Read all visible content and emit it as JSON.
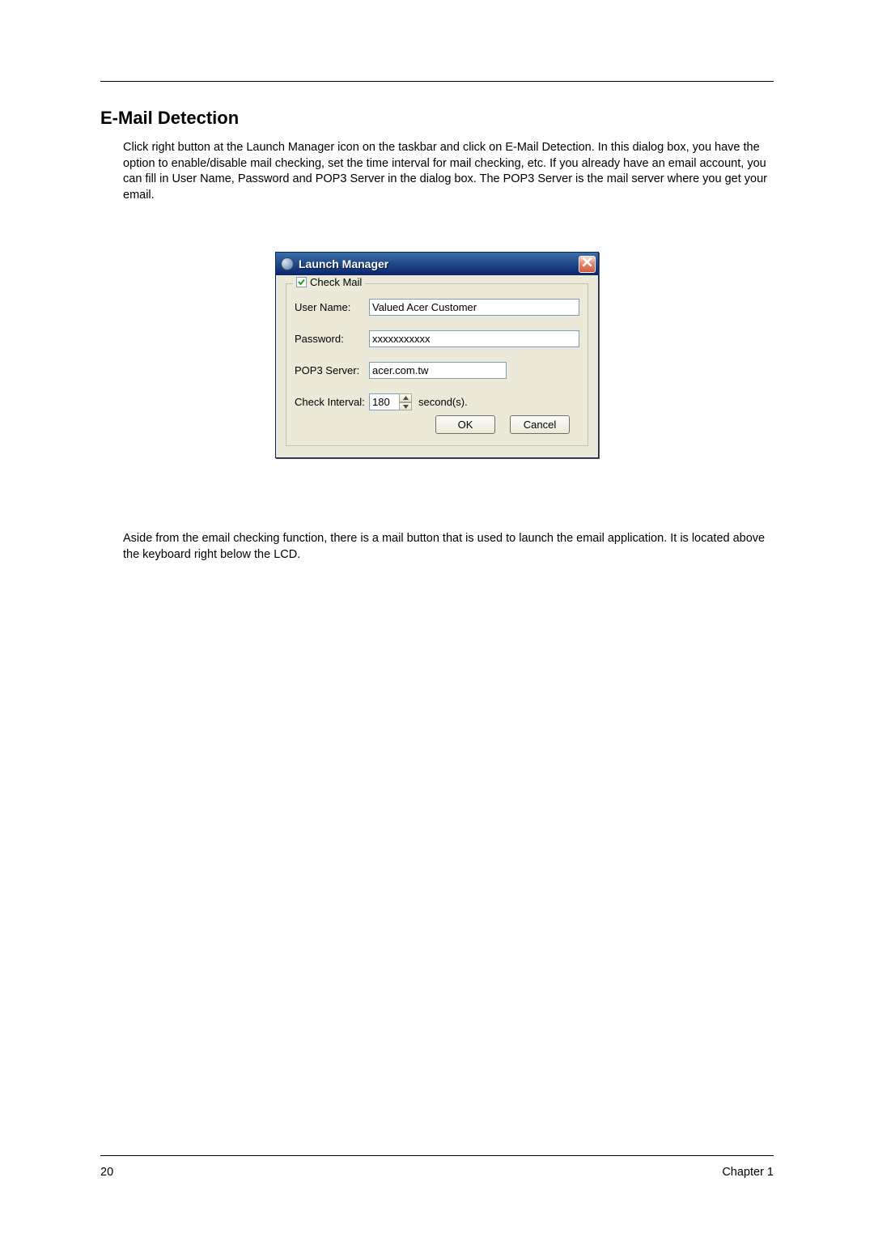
{
  "heading": "E-Mail Detection",
  "paragraph1": "Click right button at the Launch Manager icon on the taskbar and click on E-Mail Detection. In this dialog box, you have the option to enable/disable mail checking, set the time interval for mail checking, etc. If you already have an email account, you can fill in User Name, Password and POP3 Server in the dialog box. The POP3 Server is the mail server where you get your email.",
  "paragraph2": "Aside from the email checking function, there is a mail button that is used to launch the email application. It is located above the keyboard right below the LCD.",
  "dialog": {
    "title": "Launch Manager",
    "checkbox_label": "Check Mail",
    "labels": {
      "username": "User Name:",
      "password": "Password:",
      "pop3": "POP3 Server:",
      "interval": "Check Interval:",
      "unit": "second(s)."
    },
    "values": {
      "username": "Valued Acer Customer",
      "password": "xxxxxxxxxxx",
      "pop3": "acer.com.tw",
      "interval": "180"
    },
    "buttons": {
      "ok": "OK",
      "cancel": "Cancel"
    }
  },
  "footer": {
    "page": "20",
    "chapter": "Chapter 1"
  }
}
